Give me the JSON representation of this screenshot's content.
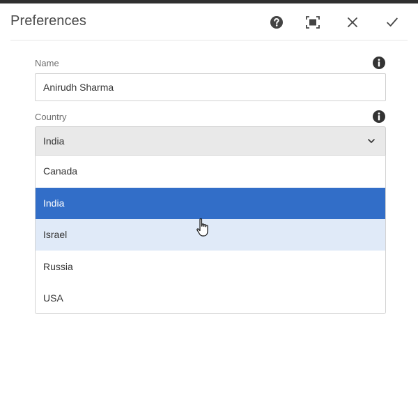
{
  "dialog": {
    "title": "Preferences"
  },
  "form": {
    "name_label": "Name",
    "name_value": "Anirudh Sharma",
    "country_label": "Country",
    "country_selected": "India",
    "country_options": [
      "Canada",
      "India",
      "Israel",
      "Russia",
      "USA"
    ],
    "highlighted_option": "India",
    "hovered_option": "Israel"
  },
  "icons": {
    "help": "help-circle-icon",
    "fullscreen": "fullscreen-icon",
    "close": "close-icon",
    "done": "checkmark-icon",
    "info": "info-icon",
    "dropdown": "chevron-down-icon",
    "pointer": "hand-pointer-icon"
  },
  "colors": {
    "selected_option_bg": "#326ec8",
    "hover_option_bg": "#e0eaf8",
    "select_bg": "#e9e9e9"
  }
}
